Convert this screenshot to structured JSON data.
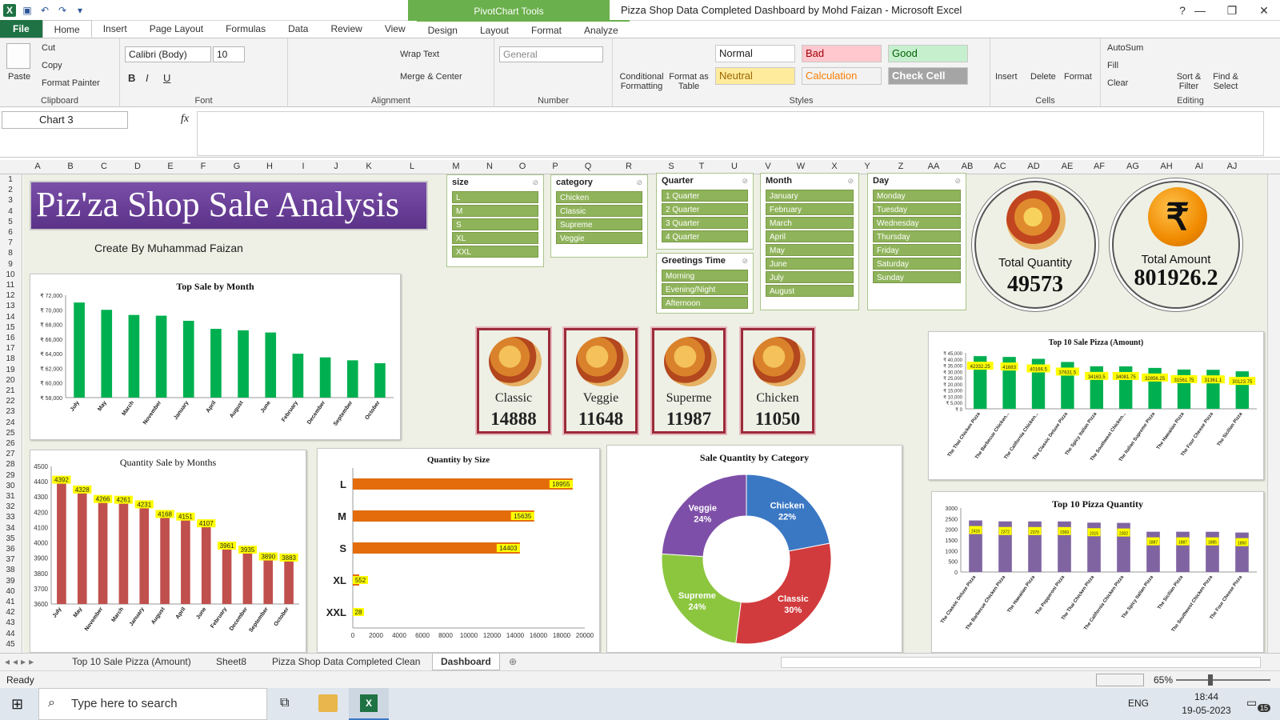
{
  "window": {
    "title": "Pizza Shop Data Completed Dashboard by Mohd Faizan  -  Microsoft Excel",
    "tool_band": "PivotChart Tools",
    "colors": {
      "excel_green": "#1f7244",
      "tool_green": "#6ab04c"
    }
  },
  "ribbon_tabs": [
    "File",
    "Home",
    "Insert",
    "Page Layout",
    "Formulas",
    "Data",
    "Review",
    "View",
    "Design",
    "Layout",
    "Format",
    "Analyze"
  ],
  "ribbon": {
    "clipboard": {
      "paste": "Paste",
      "cut": "Cut",
      "copy": "Copy",
      "format_painter": "Format Painter",
      "label": "Clipboard"
    },
    "font": {
      "name": "Calibri (Body)",
      "size": "10",
      "label": "Font"
    },
    "alignment": {
      "wrap": "Wrap Text",
      "merge": "Merge & Center",
      "label": "Alignment"
    },
    "number": {
      "format": "General",
      "label": "Number"
    },
    "styles": {
      "conditional": "Conditional Formatting",
      "format_table": "Format as Table",
      "normal": "Normal",
      "bad": "Bad",
      "good": "Good",
      "neutral": "Neutral",
      "calculation": "Calculation",
      "check_cell": "Check Cell",
      "label": "Styles"
    },
    "cells": {
      "insert": "Insert",
      "delete": "Delete",
      "format": "Format",
      "label": "Cells"
    },
    "editing": {
      "autosum": "AutoSum",
      "fill": "Fill",
      "clear": "Clear",
      "sort": "Sort & Filter",
      "find": "Find & Select",
      "label": "Editing"
    }
  },
  "formula_bar": {
    "name_box": "Chart 3",
    "fx": "fx"
  },
  "columns": [
    "A",
    "B",
    "C",
    "D",
    "E",
    "F",
    "G",
    "H",
    "I",
    "J",
    "K",
    "L",
    "M",
    "N",
    "O",
    "P",
    "Q",
    "R",
    "S",
    "T",
    "U",
    "V",
    "W",
    "X",
    "Y",
    "Z",
    "AA",
    "AB",
    "AC",
    "AD",
    "AE",
    "AF",
    "AG",
    "AH",
    "AI",
    "AJ"
  ],
  "rows": [
    "1",
    "2",
    "3",
    "4",
    "5",
    "6",
    "7",
    "8",
    "9",
    "10",
    "11",
    "12",
    "13",
    "14",
    "15",
    "16",
    "17",
    "18",
    "19",
    "20",
    "21",
    "22",
    "23",
    "24",
    "25",
    "26",
    "27",
    "28",
    "29",
    "30",
    "31",
    "32",
    "33",
    "34",
    "35",
    "36",
    "37",
    "38",
    "39",
    "40",
    "41",
    "42",
    "43",
    "44",
    "45"
  ],
  "dashboard": {
    "title": "Piz'za Shop Sale Analysis",
    "creator": "Create By Muhammad Faizan",
    "kpi": {
      "qty_label": "Total Quantity",
      "qty_value": "49573",
      "amount_label": "Total Amount",
      "amount_value": "801926.2"
    },
    "pizzas": [
      {
        "name": "Classic",
        "value": "14888"
      },
      {
        "name": "Veggie",
        "value": "11648"
      },
      {
        "name": "Superme",
        "value": "11987"
      },
      {
        "name": "Chicken",
        "value": "11050"
      }
    ],
    "slicers": {
      "size": {
        "title": "size",
        "items": [
          "L",
          "M",
          "S",
          "XL",
          "XXL"
        ]
      },
      "category": {
        "title": "category",
        "items": [
          "Chicken",
          "Classic",
          "Supreme",
          "Veggie"
        ]
      },
      "quarter": {
        "title": "Quarter",
        "items": [
          "1 Quarter",
          "2 Quarter",
          "3 Quarter",
          "4 Quarter"
        ]
      },
      "greeting": {
        "title": "Greetings Time",
        "items": [
          "Morning",
          "Evening/Night",
          "Afternoon"
        ]
      },
      "month": {
        "title": "Month",
        "items": [
          "January",
          "February",
          "March",
          "April",
          "May",
          "June",
          "July",
          "August"
        ]
      },
      "day": {
        "title": "Day",
        "items": [
          "Monday",
          "Tuesday",
          "Wednesday",
          "Thursday",
          "Friday",
          "Saturday",
          "Sunday"
        ]
      }
    }
  },
  "chart_data": [
    {
      "type": "bar",
      "title": "Top Sale by Month",
      "categories": [
        "July",
        "May",
        "March",
        "November",
        "January",
        "April",
        "August",
        "June",
        "February",
        "December",
        "September",
        "October"
      ],
      "values": [
        71000,
        70000,
        69300,
        69200,
        68500,
        67400,
        67200,
        66900,
        64000,
        63500,
        63100,
        62700
      ],
      "ylim": [
        58000,
        72000
      ],
      "ticks": [
        "₹ 58,000",
        "₹ 60,000",
        "₹ 62,000",
        "₹ 64,000",
        "₹ 66,000",
        "₹ 68,000",
        "₹ 70,000",
        "₹ 72,000"
      ],
      "color": "#00b050"
    },
    {
      "type": "bar",
      "title": "Quantity Sale by Months",
      "categories": [
        "July",
        "May",
        "November",
        "March",
        "January",
        "August",
        "April",
        "June",
        "February",
        "December",
        "September",
        "October"
      ],
      "values": [
        4392,
        4328,
        4266,
        4261,
        4231,
        4168,
        4151,
        4107,
        3961,
        3935,
        3890,
        3883
      ],
      "ylim": [
        3600,
        4500
      ],
      "ticks": [
        "3600",
        "3700",
        "3800",
        "3900",
        "4000",
        "4100",
        "4200",
        "4300",
        "4400",
        "4500"
      ],
      "color": "#c0504d"
    },
    {
      "type": "bar",
      "orientation": "horizontal",
      "title": "Quantity by Size",
      "categories": [
        "L",
        "M",
        "S",
        "XL",
        "XXL"
      ],
      "values": [
        18955,
        15635,
        14403,
        552,
        28
      ],
      "xlim": [
        0,
        20000
      ],
      "ticks": [
        "0",
        "2000",
        "4000",
        "6000",
        "8000",
        "10000",
        "12000",
        "14000",
        "16000",
        "18000",
        "20000"
      ],
      "color": "#e46c0a"
    },
    {
      "type": "pie",
      "title": "Sale Quantity by Category",
      "labels": [
        "Chicken",
        "Classic",
        "Supreme",
        "Veggie"
      ],
      "percent": [
        "22%",
        "30%",
        "24%",
        "24%"
      ],
      "values": [
        22,
        30,
        24,
        24
      ],
      "colors": [
        "#3b78c4",
        "#d23b3d",
        "#8cc63f",
        "#7e4fa8"
      ]
    },
    {
      "type": "bar",
      "title": "Top 10 Sale Pizza  (Amount)",
      "categories": [
        "The Thai Chicken Pizza",
        "The Barbecue Chicken...",
        "The California Chicken...",
        "The Classic Deluxe Pizza",
        "The Spicy Italian Pizza",
        "The Southwest Chicken...",
        "The Italian Supreme Pizza",
        "The Hawaiian Pizza",
        "The Four Cheese Pizza",
        "The Sicilian Pizza"
      ],
      "values": [
        42332.25,
        41683,
        40166.5,
        37631.5,
        34163.5,
        34081.75,
        32856.25,
        31561.75,
        31361.1,
        30123.75
      ],
      "labels": [
        "42332.25",
        "41683",
        "40166.5",
        "37631.5",
        "34163.5",
        "34081.75",
        "32856.25",
        "31561.75",
        "31361.1",
        "30123.75"
      ],
      "ylim": [
        0,
        45000
      ],
      "ticks": [
        "₹ 0",
        "₹ 5,000",
        "₹ 10,000",
        "₹ 15,000",
        "₹ 20,000",
        "₹ 25,000",
        "₹ 30,000",
        "₹ 35,000",
        "₹ 40,000",
        "₹ 45,000"
      ],
      "color": "#00b050"
    },
    {
      "type": "bar",
      "title": "Top 10 Pizza Quantity",
      "categories": [
        "The Classic Deluxe Pizza",
        "The Barbecue Chicken Pizza",
        "The Hawaiian Pizza",
        "The Pepperoni Pizza",
        "The Thai Chicken Pizza",
        "The California Chicken Pizza",
        "The Spicy Italian Pizza",
        "The Sicilian Pizza",
        "The Southwest Chicken Pizza",
        "The Four Cheese Pizza"
      ],
      "values": [
        2416,
        2372,
        2370,
        2369,
        2315,
        2302,
        1887,
        1887,
        1885,
        1850
      ],
      "ylim": [
        0,
        3000
      ],
      "ticks": [
        "0",
        "500",
        "1000",
        "1500",
        "2000",
        "2500",
        "3000"
      ],
      "color": "#8064a2"
    }
  ],
  "sheet_tabs": [
    "Top 10 Sale Pizza (Amount)",
    "Sheet8",
    "Pizza Shop Data Completed Clean",
    "Dashboard"
  ],
  "status": {
    "ready": "Ready",
    "zoom": "65%"
  },
  "taskbar": {
    "search": "Type here to search",
    "lang": "ENG",
    "time": "18:44",
    "date": "19-05-2023",
    "notif": "15"
  }
}
